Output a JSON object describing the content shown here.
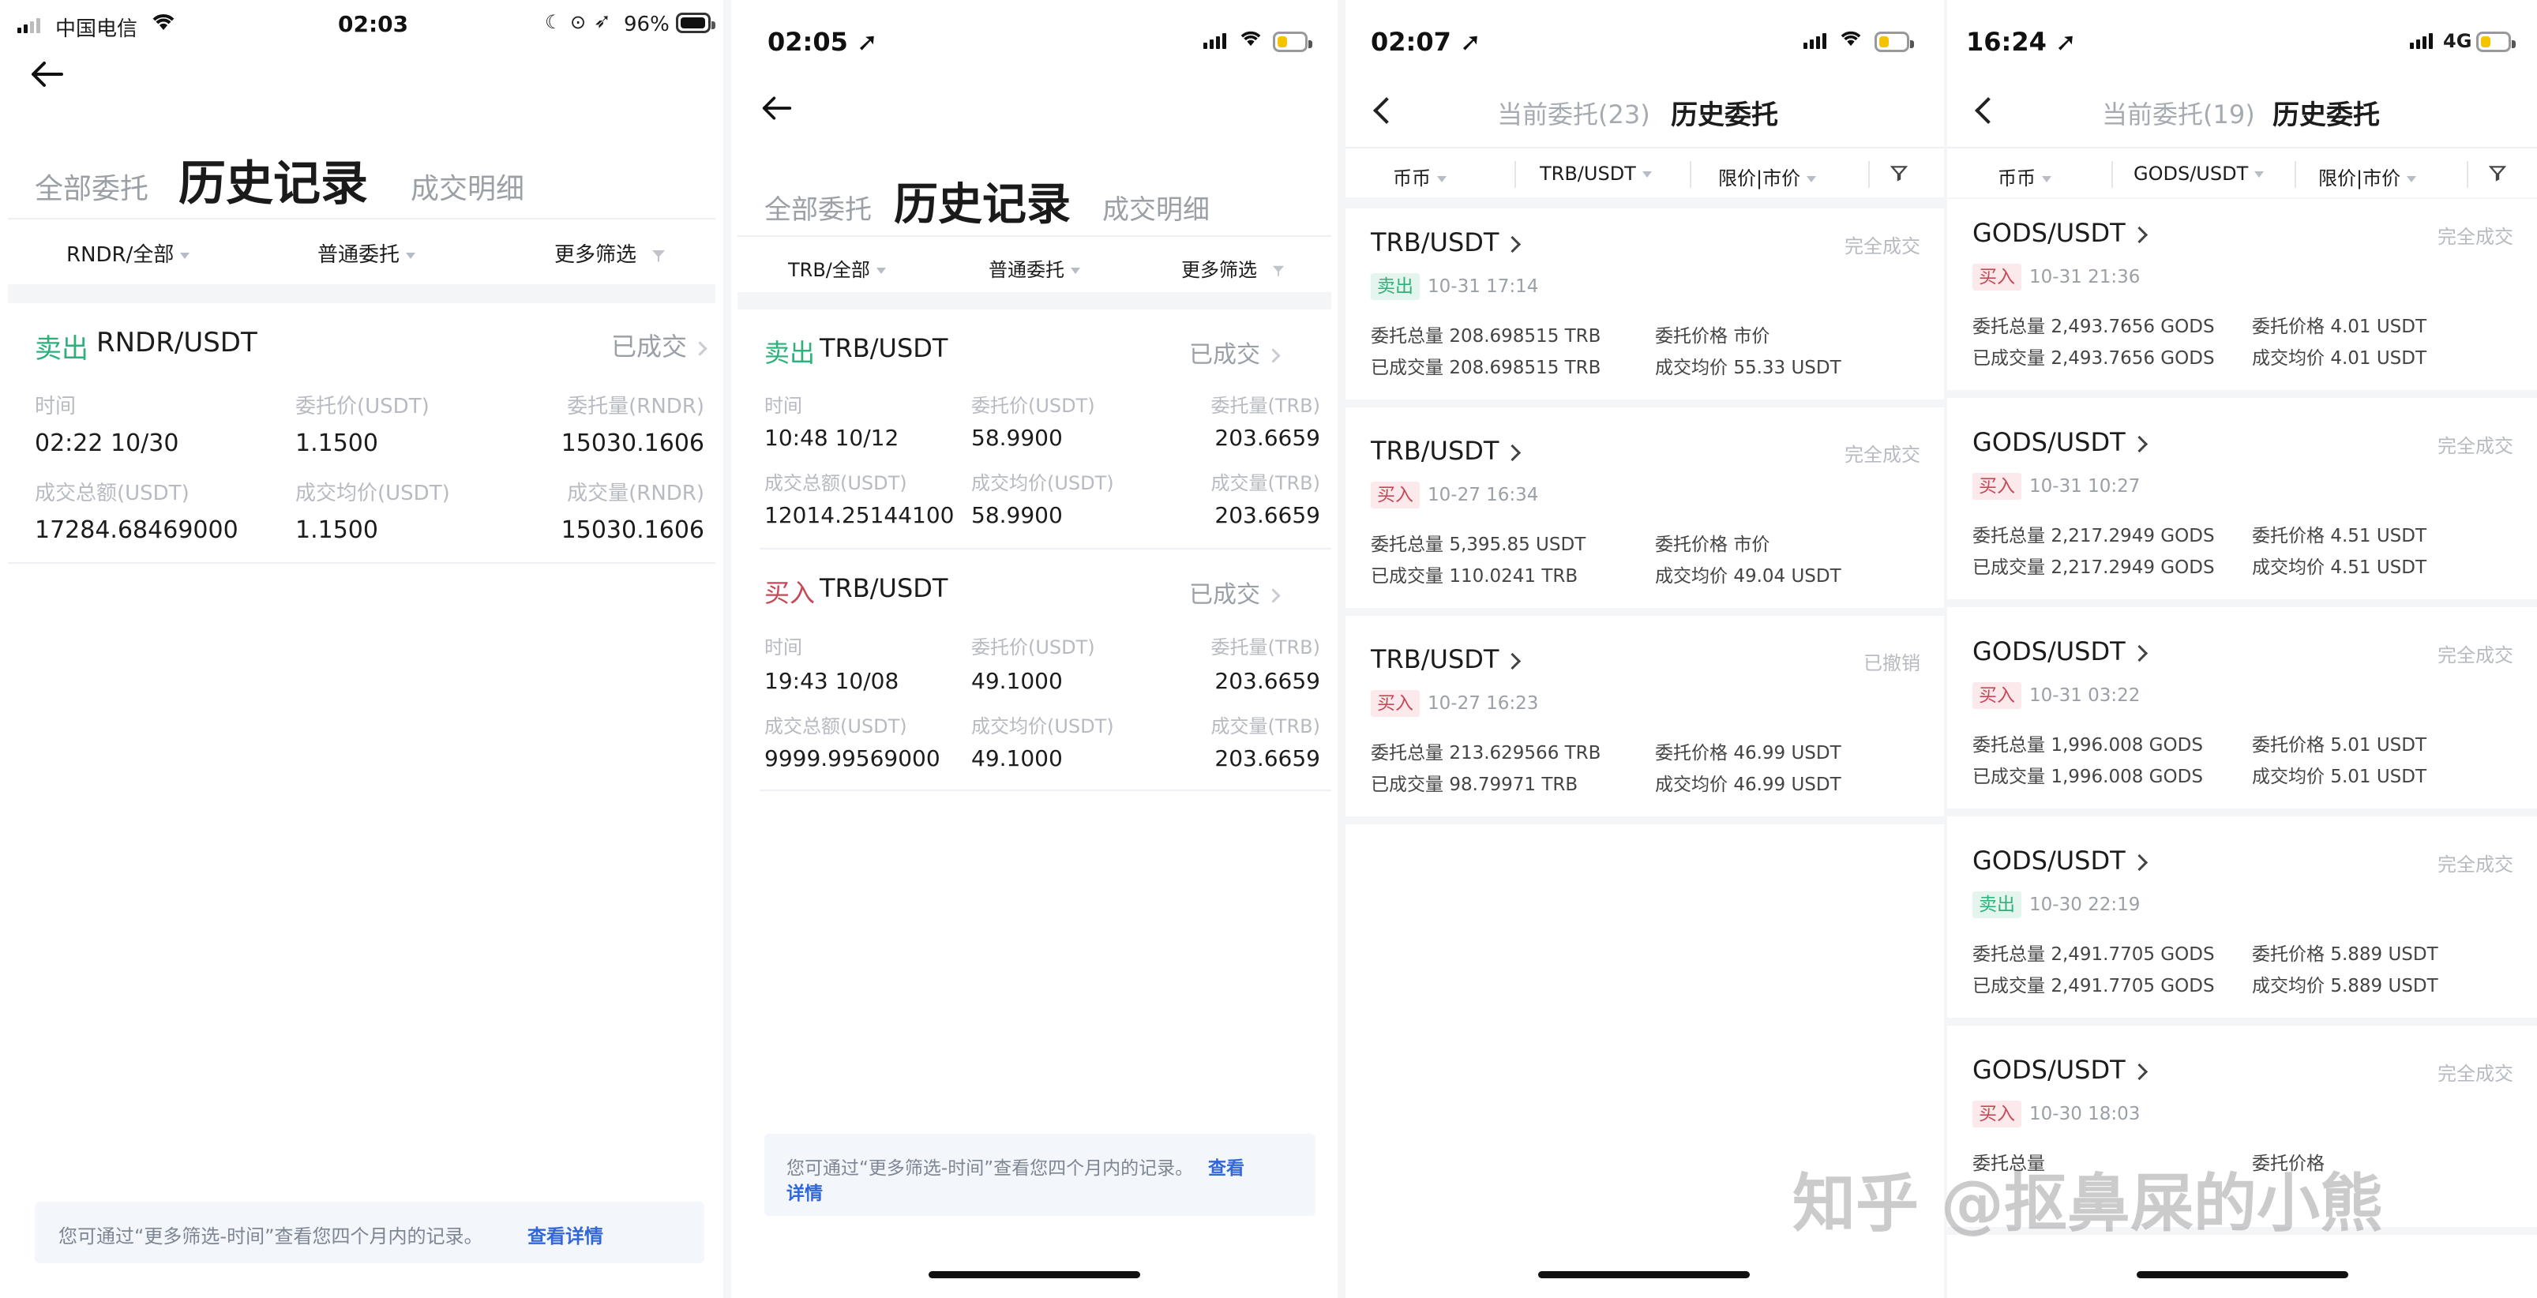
{
  "p1": {
    "status": {
      "carrier": "中国电信",
      "time": "02:03",
      "battery": "96%"
    },
    "tabs": {
      "all": "全部委托",
      "history": "历史记录",
      "deals": "成交明细"
    },
    "filters": {
      "pair": "RNDR/全部",
      "type": "普通委托",
      "more": "更多筛选"
    },
    "order": {
      "side": "卖出",
      "pair": "RNDR/USDT",
      "status": "已成交",
      "labels": [
        "时间",
        "委托价(USDT)",
        "委托量(RNDR)",
        "成交总额(USDT)",
        "成交均价(USDT)",
        "成交量(RNDR)"
      ],
      "values": [
        "02:22 10/30",
        "1.1500",
        "15030.1606",
        "17284.68469000",
        "1.1500",
        "15030.1606"
      ]
    },
    "note": {
      "text": "您可通过“更多筛选-时间”查看您四个月内的记录。",
      "link": "查看详情"
    }
  },
  "p2": {
    "status": {
      "time": "02:05"
    },
    "tabs": {
      "all": "全部委托",
      "history": "历史记录",
      "deals": "成交明细"
    },
    "filters": {
      "pair": "TRB/全部",
      "type": "普通委托",
      "more": "更多筛选"
    },
    "orders": [
      {
        "side": "卖出",
        "pair": "TRB/USDT",
        "status": "已成交",
        "labels": [
          "时间",
          "委托价(USDT)",
          "委托量(TRB)",
          "成交总额(USDT)",
          "成交均价(USDT)",
          "成交量(TRB)"
        ],
        "values": [
          "10:48 10/12",
          "58.9900",
          "203.6659",
          "12014.25144100",
          "58.9900",
          "203.6659"
        ]
      },
      {
        "side": "买入",
        "pair": "TRB/USDT",
        "status": "已成交",
        "labels": [
          "时间",
          "委托价(USDT)",
          "委托量(TRB)",
          "成交总额(USDT)",
          "成交均价(USDT)",
          "成交量(TRB)"
        ],
        "values": [
          "19:43 10/08",
          "49.1000",
          "203.6659",
          "9999.99569000",
          "49.1000",
          "203.6659"
        ]
      }
    ],
    "note": {
      "text": "您可通过“更多筛选-时间”查看您四个月内的记录。",
      "link1": "查看",
      "link2": "详情"
    }
  },
  "p3": {
    "status": {
      "time": "02:07"
    },
    "tabs": {
      "current": "当前委托(23)",
      "history": "历史委托"
    },
    "filters": {
      "coin": "币币",
      "pair": "TRB/USDT",
      "type": "限价|市价"
    },
    "orders": [
      {
        "pair": "TRB/USDT",
        "status": "完全成交",
        "side": "卖出",
        "time": "10-31 17:14",
        "l1": "委托总量",
        "v1": "208.698515 TRB",
        "l2": "委托价格",
        "v2": "市价",
        "l3": "已成交量",
        "v3": "208.698515 TRB",
        "l4": "成交均价",
        "v4": "55.33 USDT"
      },
      {
        "pair": "TRB/USDT",
        "status": "完全成交",
        "side": "买入",
        "time": "10-27 16:34",
        "l1": "委托总量",
        "v1": "5,395.85 USDT",
        "l2": "委托价格",
        "v2": "市价",
        "l3": "已成交量",
        "v3": "110.0241 TRB",
        "l4": "成交均价",
        "v4": "49.04 USDT"
      },
      {
        "pair": "TRB/USDT",
        "status": "已撤销",
        "side": "买入",
        "time": "10-27 16:23",
        "l1": "委托总量",
        "v1": "213.629566 TRB",
        "l2": "委托价格",
        "v2": "46.99 USDT",
        "l3": "已成交量",
        "v3": "98.79971 TRB",
        "l4": "成交均价",
        "v4": "46.99 USDT"
      }
    ]
  },
  "p4": {
    "status": {
      "time": "16:24",
      "network": "4G"
    },
    "tabs": {
      "current": "当前委托(19)",
      "history": "历史委托"
    },
    "filters": {
      "coin": "币币",
      "pair": "GODS/USDT",
      "type": "限价|市价"
    },
    "orders": [
      {
        "pair": "GODS/USDT",
        "status": "完全成交",
        "side": "买入",
        "time": "10-31 21:36",
        "l1": "委托总量",
        "v1": "2,493.7656 GODS",
        "l2": "委托价格",
        "v2": "4.01 USDT",
        "l3": "已成交量",
        "v3": "2,493.7656 GODS",
        "l4": "成交均价",
        "v4": "4.01 USDT"
      },
      {
        "pair": "GODS/USDT",
        "status": "完全成交",
        "side": "买入",
        "time": "10-31 10:27",
        "l1": "委托总量",
        "v1": "2,217.2949 GODS",
        "l2": "委托价格",
        "v2": "4.51 USDT",
        "l3": "已成交量",
        "v3": "2,217.2949 GODS",
        "l4": "成交均价",
        "v4": "4.51 USDT"
      },
      {
        "pair": "GODS/USDT",
        "status": "完全成交",
        "side": "买入",
        "time": "10-31 03:22",
        "l1": "委托总量",
        "v1": "1,996.008 GODS",
        "l2": "委托价格",
        "v2": "5.01 USDT",
        "l3": "已成交量",
        "v3": "1,996.008 GODS",
        "l4": "成交均价",
        "v4": "5.01 USDT"
      },
      {
        "pair": "GODS/USDT",
        "status": "完全成交",
        "side": "卖出",
        "time": "10-30 22:19",
        "l1": "委托总量",
        "v1": "2,491.7705 GODS",
        "l2": "委托价格",
        "v2": "5.889 USDT",
        "l3": "已成交量",
        "v3": "2,491.7705 GODS",
        "l4": "成交均价",
        "v4": "5.889 USDT"
      },
      {
        "pair": "GODS/USDT",
        "status": "完全成交",
        "side": "买入",
        "time": "10-30 18:03",
        "l1": "委托总量",
        "v1": "",
        "l2": "委托价格",
        "v2": "",
        "l3": "",
        "v3": "",
        "l4": "",
        "v4": ""
      }
    ]
  },
  "watermark": "知乎 @抠鼻屎的小熊",
  "colors": {
    "buy": "#c54a57",
    "sell": "#2eb07a",
    "link": "#3167d8",
    "muted": "#9aa0a6"
  }
}
